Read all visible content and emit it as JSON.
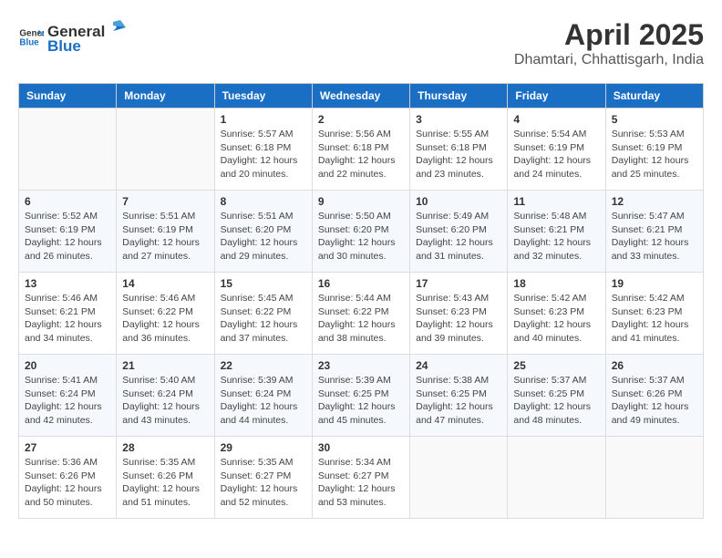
{
  "header": {
    "logo_general": "General",
    "logo_blue": "Blue",
    "main_title": "April 2025",
    "subtitle": "Dhamtari, Chhattisgarh, India"
  },
  "calendar": {
    "days_of_week": [
      "Sunday",
      "Monday",
      "Tuesday",
      "Wednesday",
      "Thursday",
      "Friday",
      "Saturday"
    ],
    "weeks": [
      [
        {
          "day": "",
          "info": ""
        },
        {
          "day": "",
          "info": ""
        },
        {
          "day": "1",
          "info": "Sunrise: 5:57 AM\nSunset: 6:18 PM\nDaylight: 12 hours and 20 minutes."
        },
        {
          "day": "2",
          "info": "Sunrise: 5:56 AM\nSunset: 6:18 PM\nDaylight: 12 hours and 22 minutes."
        },
        {
          "day": "3",
          "info": "Sunrise: 5:55 AM\nSunset: 6:18 PM\nDaylight: 12 hours and 23 minutes."
        },
        {
          "day": "4",
          "info": "Sunrise: 5:54 AM\nSunset: 6:19 PM\nDaylight: 12 hours and 24 minutes."
        },
        {
          "day": "5",
          "info": "Sunrise: 5:53 AM\nSunset: 6:19 PM\nDaylight: 12 hours and 25 minutes."
        }
      ],
      [
        {
          "day": "6",
          "info": "Sunrise: 5:52 AM\nSunset: 6:19 PM\nDaylight: 12 hours and 26 minutes."
        },
        {
          "day": "7",
          "info": "Sunrise: 5:51 AM\nSunset: 6:19 PM\nDaylight: 12 hours and 27 minutes."
        },
        {
          "day": "8",
          "info": "Sunrise: 5:51 AM\nSunset: 6:20 PM\nDaylight: 12 hours and 29 minutes."
        },
        {
          "day": "9",
          "info": "Sunrise: 5:50 AM\nSunset: 6:20 PM\nDaylight: 12 hours and 30 minutes."
        },
        {
          "day": "10",
          "info": "Sunrise: 5:49 AM\nSunset: 6:20 PM\nDaylight: 12 hours and 31 minutes."
        },
        {
          "day": "11",
          "info": "Sunrise: 5:48 AM\nSunset: 6:21 PM\nDaylight: 12 hours and 32 minutes."
        },
        {
          "day": "12",
          "info": "Sunrise: 5:47 AM\nSunset: 6:21 PM\nDaylight: 12 hours and 33 minutes."
        }
      ],
      [
        {
          "day": "13",
          "info": "Sunrise: 5:46 AM\nSunset: 6:21 PM\nDaylight: 12 hours and 34 minutes."
        },
        {
          "day": "14",
          "info": "Sunrise: 5:46 AM\nSunset: 6:22 PM\nDaylight: 12 hours and 36 minutes."
        },
        {
          "day": "15",
          "info": "Sunrise: 5:45 AM\nSunset: 6:22 PM\nDaylight: 12 hours and 37 minutes."
        },
        {
          "day": "16",
          "info": "Sunrise: 5:44 AM\nSunset: 6:22 PM\nDaylight: 12 hours and 38 minutes."
        },
        {
          "day": "17",
          "info": "Sunrise: 5:43 AM\nSunset: 6:23 PM\nDaylight: 12 hours and 39 minutes."
        },
        {
          "day": "18",
          "info": "Sunrise: 5:42 AM\nSunset: 6:23 PM\nDaylight: 12 hours and 40 minutes."
        },
        {
          "day": "19",
          "info": "Sunrise: 5:42 AM\nSunset: 6:23 PM\nDaylight: 12 hours and 41 minutes."
        }
      ],
      [
        {
          "day": "20",
          "info": "Sunrise: 5:41 AM\nSunset: 6:24 PM\nDaylight: 12 hours and 42 minutes."
        },
        {
          "day": "21",
          "info": "Sunrise: 5:40 AM\nSunset: 6:24 PM\nDaylight: 12 hours and 43 minutes."
        },
        {
          "day": "22",
          "info": "Sunrise: 5:39 AM\nSunset: 6:24 PM\nDaylight: 12 hours and 44 minutes."
        },
        {
          "day": "23",
          "info": "Sunrise: 5:39 AM\nSunset: 6:25 PM\nDaylight: 12 hours and 45 minutes."
        },
        {
          "day": "24",
          "info": "Sunrise: 5:38 AM\nSunset: 6:25 PM\nDaylight: 12 hours and 47 minutes."
        },
        {
          "day": "25",
          "info": "Sunrise: 5:37 AM\nSunset: 6:25 PM\nDaylight: 12 hours and 48 minutes."
        },
        {
          "day": "26",
          "info": "Sunrise: 5:37 AM\nSunset: 6:26 PM\nDaylight: 12 hours and 49 minutes."
        }
      ],
      [
        {
          "day": "27",
          "info": "Sunrise: 5:36 AM\nSunset: 6:26 PM\nDaylight: 12 hours and 50 minutes."
        },
        {
          "day": "28",
          "info": "Sunrise: 5:35 AM\nSunset: 6:26 PM\nDaylight: 12 hours and 51 minutes."
        },
        {
          "day": "29",
          "info": "Sunrise: 5:35 AM\nSunset: 6:27 PM\nDaylight: 12 hours and 52 minutes."
        },
        {
          "day": "30",
          "info": "Sunrise: 5:34 AM\nSunset: 6:27 PM\nDaylight: 12 hours and 53 minutes."
        },
        {
          "day": "",
          "info": ""
        },
        {
          "day": "",
          "info": ""
        },
        {
          "day": "",
          "info": ""
        }
      ]
    ]
  }
}
